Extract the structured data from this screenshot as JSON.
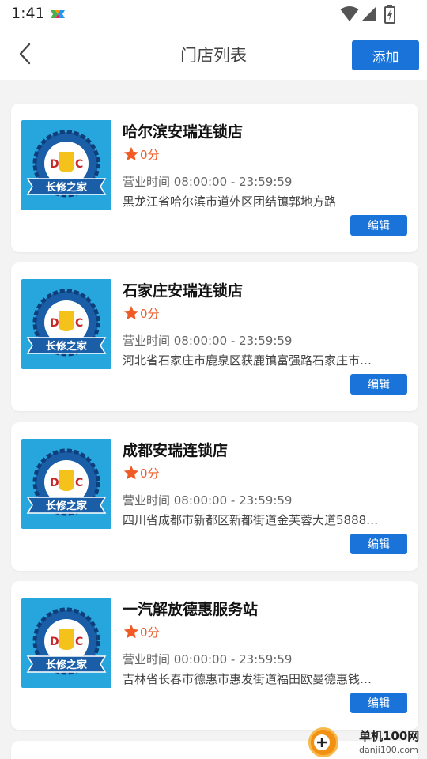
{
  "status_bar": {
    "time": "1:41",
    "icons": [
      "app-notification-icon",
      "wifi-icon",
      "cellular-signal-icon",
      "battery-charging-icon"
    ]
  },
  "header": {
    "title": "门店列表",
    "back_icon": "chevron-left-icon",
    "add_label": "添加"
  },
  "stores": [
    {
      "name": "哈尔滨安瑞连锁店",
      "rating": "0分",
      "hours": "营业时间 08:00:00 - 23:59:59",
      "address": "黑龙江省哈尔滨市道外区团结镇郭地方路",
      "edit_label": "编辑",
      "logo_text": "长修之家"
    },
    {
      "name": "石家庄安瑞连锁店",
      "rating": "0分",
      "hours": "营业时间 08:00:00 - 23:59:59",
      "address": "河北省石家庄市鹿泉区获鹿镇富强路石家庄市…",
      "edit_label": "编辑",
      "logo_text": "长修之家"
    },
    {
      "name": "成都安瑞连锁店",
      "rating": "0分",
      "hours": "营业时间 08:00:00 - 23:59:59",
      "address": "四川省成都市新都区新都街道金芙蓉大道5888…",
      "edit_label": "编辑",
      "logo_text": "长修之家"
    },
    {
      "name": "一汽解放德惠服务站",
      "rating": "0分",
      "hours": "营业时间 00:00:00 - 23:59:59",
      "address": "吉林省长春市德惠市惠发街道福田欧曼德惠钱…",
      "edit_label": "编辑",
      "logo_text": "长修之家"
    }
  ],
  "watermark": {
    "title": "单机100网",
    "url": "danji100.com"
  },
  "colors": {
    "primary": "#1a73d8",
    "rating": "#f05a24",
    "logo_bg": "#27a6de"
  }
}
